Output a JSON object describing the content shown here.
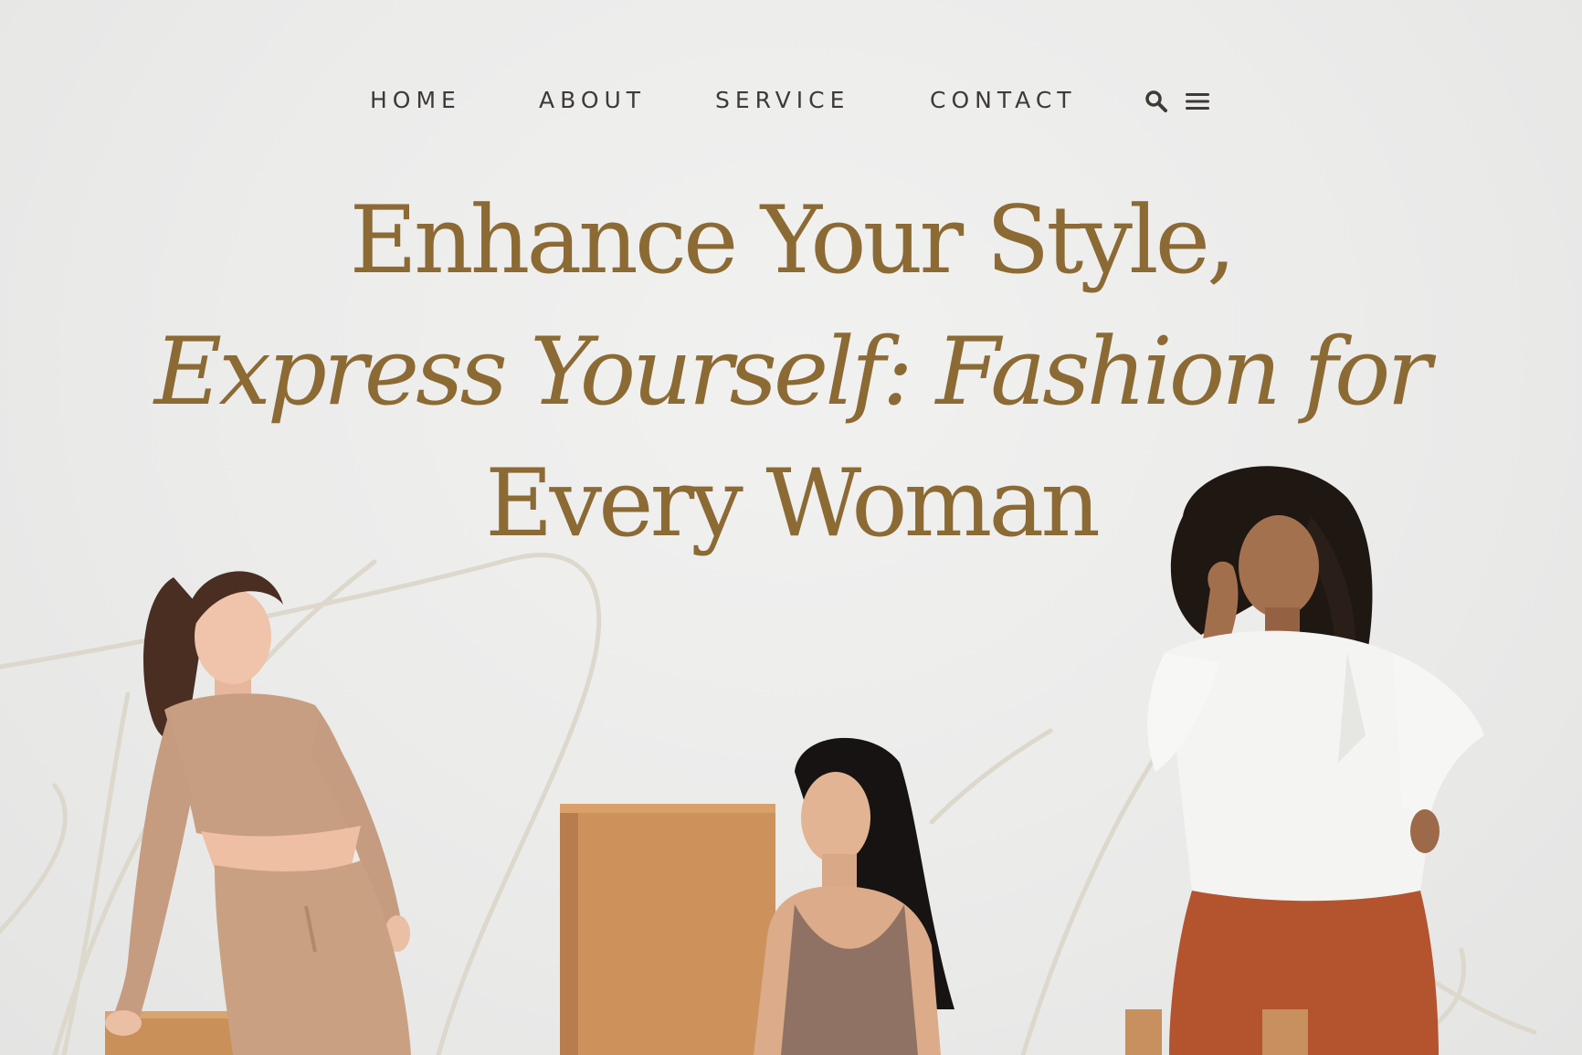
{
  "nav": {
    "links": [
      {
        "label": "HOME"
      },
      {
        "label": "ABOUT"
      },
      {
        "label": "SERVICE"
      },
      {
        "label": "CONTACT"
      }
    ],
    "icons": [
      "search-icon",
      "menu-icon"
    ]
  },
  "hero": {
    "title_line1": "Enhance Your Style,",
    "title_line2": "Express Yourself: Fashion for",
    "title_line3": "Every Woman"
  },
  "colors": {
    "background": "#ececeb",
    "accent_gold": "#8c6a34",
    "nav_text": "#3e3a36",
    "flourish": "#dedad0"
  }
}
